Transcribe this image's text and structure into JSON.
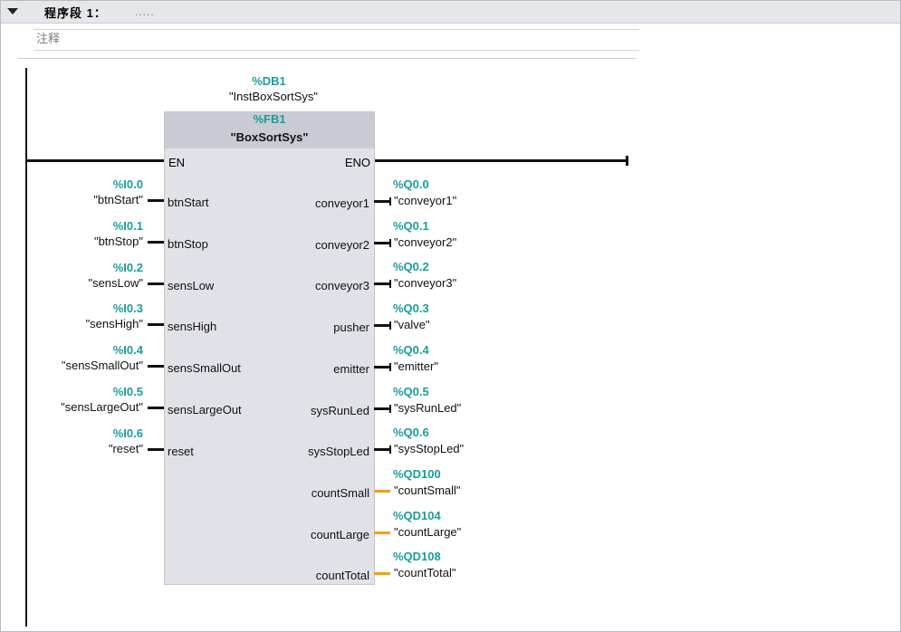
{
  "network": {
    "title": "程序段 1：",
    "dots": ".....",
    "comment": "注释"
  },
  "instance_db": {
    "address": "%DB1",
    "name": "\"InstBoxSortSys\""
  },
  "fb": {
    "address": "%FB1",
    "name": "\"BoxSortSys\"",
    "en": "EN",
    "eno": "ENO"
  },
  "inputs": [
    {
      "pin": "btnStart",
      "address": "%I0.0",
      "tag": "\"btnStart\""
    },
    {
      "pin": "btnStop",
      "address": "%I0.1",
      "tag": "\"btnStop\""
    },
    {
      "pin": "sensLow",
      "address": "%I0.2",
      "tag": "\"sensLow\""
    },
    {
      "pin": "sensHigh",
      "address": "%I0.3",
      "tag": "\"sensHigh\""
    },
    {
      "pin": "sensSmallOut",
      "address": "%I0.4",
      "tag": "\"sensSmallOut\""
    },
    {
      "pin": "sensLargeOut",
      "address": "%I0.5",
      "tag": "\"sensLargeOut\""
    },
    {
      "pin": "reset",
      "address": "%I0.6",
      "tag": "\"reset\""
    }
  ],
  "outputs": [
    {
      "pin": "conveyor1",
      "address": "%Q0.0",
      "tag": "\"conveyor1\"",
      "type": "bool"
    },
    {
      "pin": "conveyor2",
      "address": "%Q0.1",
      "tag": "\"conveyor2\"",
      "type": "bool"
    },
    {
      "pin": "conveyor3",
      "address": "%Q0.2",
      "tag": "\"conveyor3\"",
      "type": "bool"
    },
    {
      "pin": "pusher",
      "address": "%Q0.3",
      "tag": "\"valve\"",
      "type": "bool"
    },
    {
      "pin": "emitter",
      "address": "%Q0.4",
      "tag": "\"emitter\"",
      "type": "bool"
    },
    {
      "pin": "sysRunLed",
      "address": "%Q0.5",
      "tag": "\"sysRunLed\"",
      "type": "bool"
    },
    {
      "pin": "sysStopLed",
      "address": "%Q0.6",
      "tag": "\"sysStopLed\"",
      "type": "bool"
    },
    {
      "pin": "countSmall",
      "address": "%QD100",
      "tag": "\"countSmall\"",
      "type": "word"
    },
    {
      "pin": "countLarge",
      "address": "%QD104",
      "tag": "\"countLarge\"",
      "type": "word"
    },
    {
      "pin": "countTotal",
      "address": "%QD108",
      "tag": "\"countTotal\"",
      "type": "word"
    }
  ],
  "colors": {
    "address": "#1a9d9a",
    "bool_wire": "#111111",
    "word_wire": "#f0a30a"
  },
  "icons": {
    "collapse": "triangle-down-icon"
  }
}
